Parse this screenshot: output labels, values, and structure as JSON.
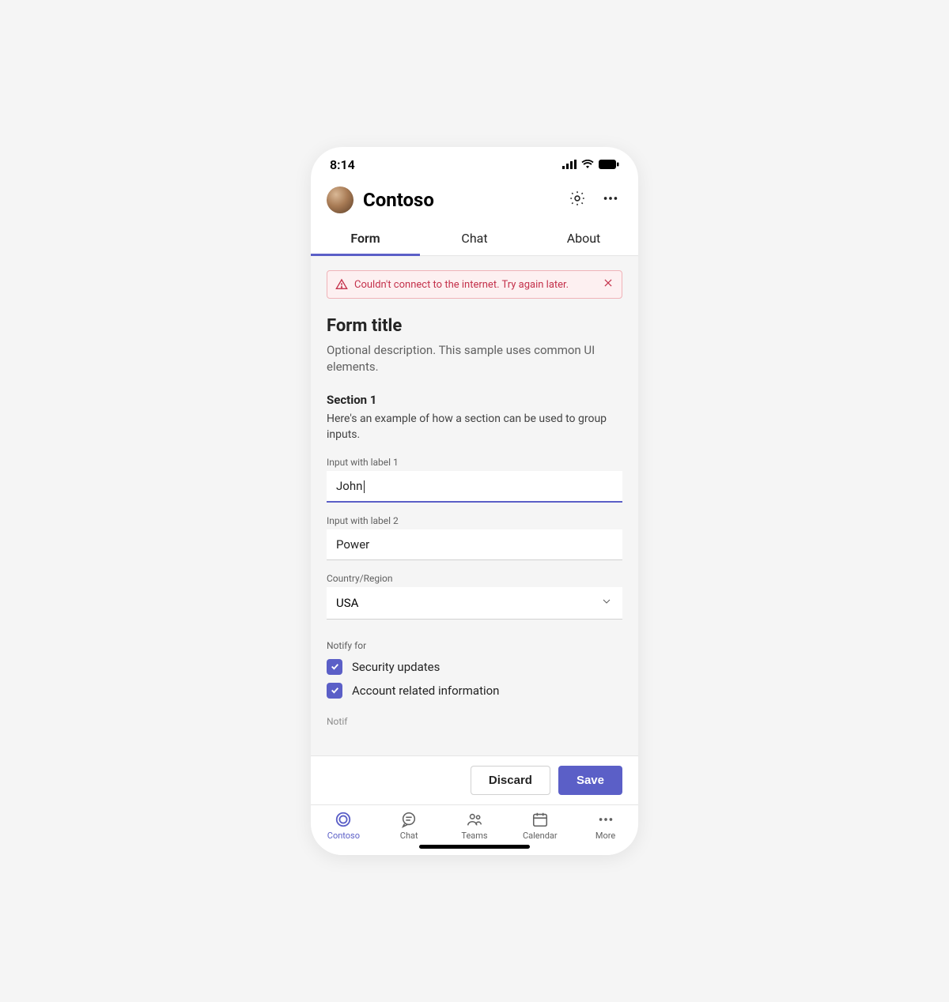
{
  "statusbar": {
    "time": "8:14"
  },
  "header": {
    "title": "Contoso"
  },
  "tabs": [
    {
      "label": "Form",
      "active": true
    },
    {
      "label": "Chat",
      "active": false
    },
    {
      "label": "About",
      "active": false
    }
  ],
  "alert": {
    "text": "Couldn't connect to the internet. Try again later."
  },
  "form": {
    "title": "Form title",
    "description": "Optional description. This sample uses common UI elements.",
    "section": {
      "title": "Section 1",
      "description": "Here's an example of how a section can be used to group inputs."
    },
    "input1": {
      "label": "Input with label 1",
      "value": "John"
    },
    "input2": {
      "label": "Input with label 2",
      "value": "Power"
    },
    "country": {
      "label": "Country/Region",
      "value": "USA"
    },
    "notify": {
      "label": "Notify for",
      "opt1": "Security updates",
      "opt2": "Account related information"
    },
    "cutoff": "Notif"
  },
  "actions": {
    "discard": "Discard",
    "save": "Save"
  },
  "nav": {
    "contoso": "Contoso",
    "chat": "Chat",
    "teams": "Teams",
    "calendar": "Calendar",
    "more": "More"
  }
}
